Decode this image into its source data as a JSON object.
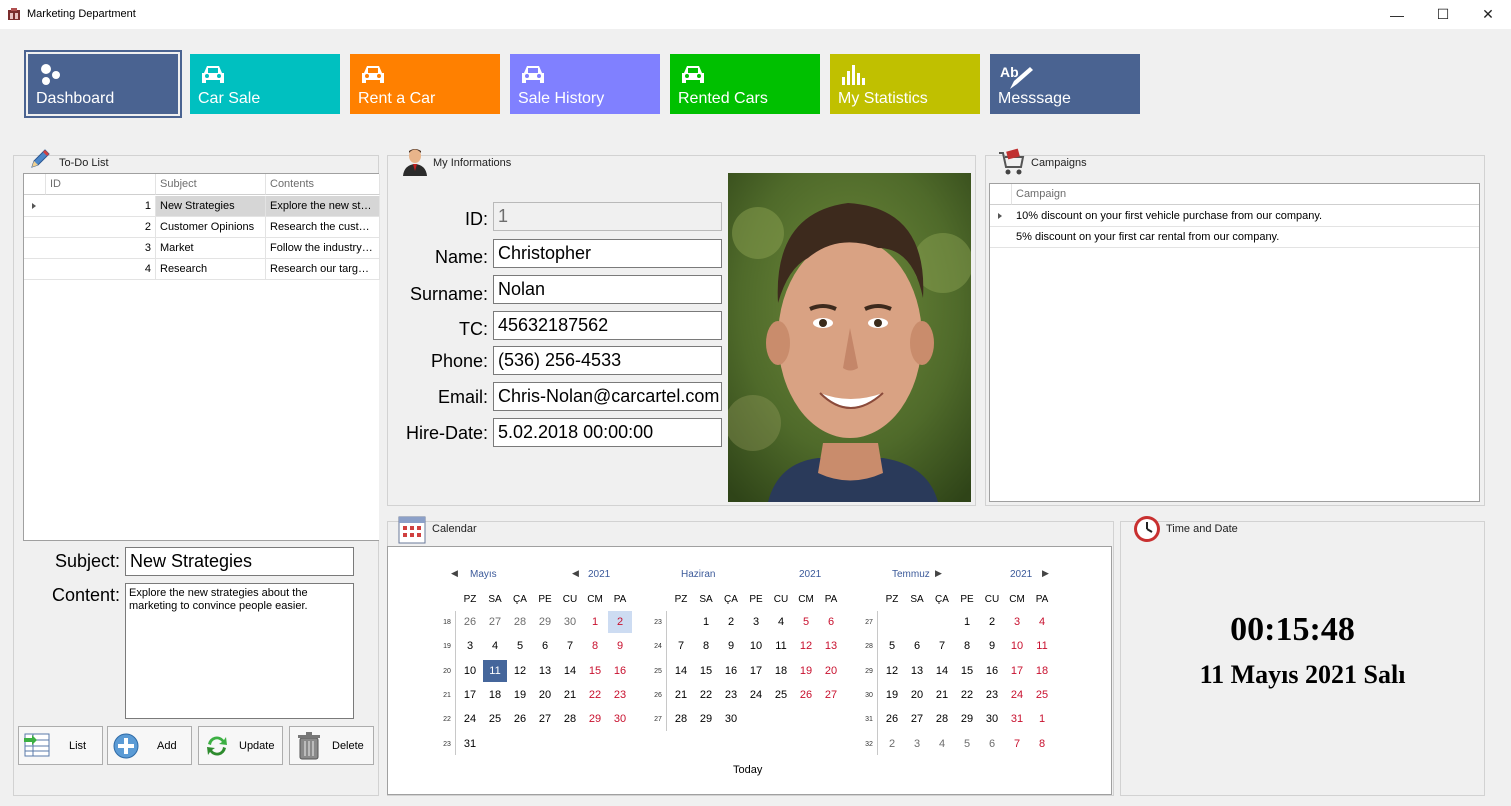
{
  "window": {
    "title": "Marketing Department",
    "minimize": "—",
    "maximize": "☐",
    "close": "✕"
  },
  "nav_tiles": [
    {
      "label": "Dashboard",
      "color": "#4a6391",
      "icon": "dashboard-icon"
    },
    {
      "label": "Car Sale",
      "color": "#00c0c0",
      "icon": "car-icon"
    },
    {
      "label": "Rent a Car",
      "color": "#ff8000",
      "icon": "car-icon"
    },
    {
      "label": "Sale History",
      "color": "#8080ff",
      "icon": "car-icon"
    },
    {
      "label": "Rented Cars",
      "color": "#00c000",
      "icon": "car-icon"
    },
    {
      "label": "My Statistics",
      "color": "#c0c000",
      "icon": "statistics-icon"
    },
    {
      "label": "Messsage",
      "color": "#4a6391",
      "icon": "spellcheck-icon"
    }
  ],
  "todo": {
    "caption": "To-Do List",
    "columns": [
      "ID",
      "Subject",
      "Contents"
    ],
    "rows": [
      {
        "id": "1",
        "subject": "New Strategies",
        "contents": "Explore the new strategies about the marketing"
      },
      {
        "id": "2",
        "subject": "Customer Opinions",
        "contents": "Research the customer opinions"
      },
      {
        "id": "3",
        "subject": "Market",
        "contents": "Follow the industry market"
      },
      {
        "id": "4",
        "subject": "Research",
        "contents": "Research our target audience"
      }
    ],
    "subject_label": "Subject:",
    "subject_value": "New Strategies",
    "content_label": "Content:",
    "content_value": "Explore the new strategies about the marketing to convince people easier.",
    "buttons": {
      "list": "List",
      "add": "Add",
      "update": "Update",
      "delete": "Delete"
    }
  },
  "info": {
    "caption": "My Informations",
    "id_label": "ID:",
    "id_value": "1",
    "name_label": "Name:",
    "name_value": "Christopher",
    "surname_label": "Surname:",
    "surname_value": "Nolan",
    "tc_label": "TC:",
    "tc_value": "45632187562",
    "phone_label": "Phone:",
    "phone_value": "(536) 256-4533",
    "email_label": "Email:",
    "email_value": "Chris-Nolan@carcartel.com",
    "hire_label": "Hire-Date:",
    "hire_value": "5.02.2018 00:00:00"
  },
  "campaigns": {
    "caption": "Campaigns",
    "column": "Campaign",
    "rows": [
      "10% discount on your first vehicle purchase from our company.",
      "5% discount on your first car rental from our company."
    ]
  },
  "calendar": {
    "caption": "Calendar",
    "day_headers": [
      "PZ",
      "SA",
      "ÇA",
      "PE",
      "CU",
      "CM",
      "PA"
    ],
    "today_label": "Today",
    "months": [
      {
        "name": "Mayıs",
        "year": "2021",
        "weeks": [
          {
            "wk": "18",
            "days": [
              {
                "d": "26",
                "o": true
              },
              {
                "d": "27",
                "o": true
              },
              {
                "d": "28",
                "o": true
              },
              {
                "d": "29",
                "o": true
              },
              {
                "d": "30",
                "o": true
              },
              {
                "d": "1"
              },
              {
                "d": "2",
                "sel": true
              }
            ]
          },
          {
            "wk": "19",
            "days": [
              {
                "d": "3"
              },
              {
                "d": "4"
              },
              {
                "d": "5"
              },
              {
                "d": "6"
              },
              {
                "d": "7"
              },
              {
                "d": "8"
              },
              {
                "d": "9"
              }
            ]
          },
          {
            "wk": "20",
            "days": [
              {
                "d": "10"
              },
              {
                "d": "11",
                "today": true
              },
              {
                "d": "12"
              },
              {
                "d": "13"
              },
              {
                "d": "14"
              },
              {
                "d": "15"
              },
              {
                "d": "16"
              }
            ]
          },
          {
            "wk": "21",
            "days": [
              {
                "d": "17"
              },
              {
                "d": "18"
              },
              {
                "d": "19"
              },
              {
                "d": "20"
              },
              {
                "d": "21"
              },
              {
                "d": "22"
              },
              {
                "d": "23"
              }
            ]
          },
          {
            "wk": "22",
            "days": [
              {
                "d": "24"
              },
              {
                "d": "25"
              },
              {
                "d": "26"
              },
              {
                "d": "27"
              },
              {
                "d": "28"
              },
              {
                "d": "29"
              },
              {
                "d": "30"
              }
            ]
          },
          {
            "wk": "23",
            "days": [
              {
                "d": "31"
              }
            ]
          }
        ]
      },
      {
        "name": "Haziran",
        "year": "2021",
        "weeks": [
          {
            "wk": "23",
            "days": [
              {
                "d": ""
              },
              {
                "d": "1"
              },
              {
                "d": "2"
              },
              {
                "d": "3"
              },
              {
                "d": "4"
              },
              {
                "d": "5"
              },
              {
                "d": "6"
              }
            ]
          },
          {
            "wk": "24",
            "days": [
              {
                "d": "7"
              },
              {
                "d": "8"
              },
              {
                "d": "9"
              },
              {
                "d": "10"
              },
              {
                "d": "11"
              },
              {
                "d": "12"
              },
              {
                "d": "13"
              }
            ]
          },
          {
            "wk": "25",
            "days": [
              {
                "d": "14"
              },
              {
                "d": "15"
              },
              {
                "d": "16"
              },
              {
                "d": "17"
              },
              {
                "d": "18"
              },
              {
                "d": "19"
              },
              {
                "d": "20"
              }
            ]
          },
          {
            "wk": "26",
            "days": [
              {
                "d": "21"
              },
              {
                "d": "22"
              },
              {
                "d": "23"
              },
              {
                "d": "24"
              },
              {
                "d": "25"
              },
              {
                "d": "26"
              },
              {
                "d": "27"
              }
            ]
          },
          {
            "wk": "27",
            "days": [
              {
                "d": "28"
              },
              {
                "d": "29"
              },
              {
                "d": "30"
              }
            ]
          }
        ]
      },
      {
        "name": "Temmuz",
        "year": "2021",
        "weeks": [
          {
            "wk": "27",
            "days": [
              {
                "d": ""
              },
              {
                "d": ""
              },
              {
                "d": ""
              },
              {
                "d": "1"
              },
              {
                "d": "2"
              },
              {
                "d": "3"
              },
              {
                "d": "4"
              }
            ]
          },
          {
            "wk": "28",
            "days": [
              {
                "d": "5"
              },
              {
                "d": "6"
              },
              {
                "d": "7"
              },
              {
                "d": "8"
              },
              {
                "d": "9"
              },
              {
                "d": "10"
              },
              {
                "d": "11"
              }
            ]
          },
          {
            "wk": "29",
            "days": [
              {
                "d": "12"
              },
              {
                "d": "13"
              },
              {
                "d": "14"
              },
              {
                "d": "15"
              },
              {
                "d": "16"
              },
              {
                "d": "17"
              },
              {
                "d": "18"
              }
            ]
          },
          {
            "wk": "30",
            "days": [
              {
                "d": "19"
              },
              {
                "d": "20"
              },
              {
                "d": "21"
              },
              {
                "d": "22"
              },
              {
                "d": "23"
              },
              {
                "d": "24"
              },
              {
                "d": "25"
              }
            ]
          },
          {
            "wk": "31",
            "days": [
              {
                "d": "26"
              },
              {
                "d": "27"
              },
              {
                "d": "28"
              },
              {
                "d": "29"
              },
              {
                "d": "30"
              },
              {
                "d": "31"
              },
              {
                "d": "1",
                "o": true
              }
            ]
          },
          {
            "wk": "32",
            "days": [
              {
                "d": "2",
                "o": true
              },
              {
                "d": "3",
                "o": true
              },
              {
                "d": "4",
                "o": true
              },
              {
                "d": "5",
                "o": true
              },
              {
                "d": "6",
                "o": true
              },
              {
                "d": "7",
                "o": true
              },
              {
                "d": "8",
                "o": true
              }
            ]
          }
        ]
      }
    ]
  },
  "clock": {
    "caption": "Time and Date",
    "time": "00:15:48",
    "date": "11 Mayıs 2021 Salı"
  }
}
